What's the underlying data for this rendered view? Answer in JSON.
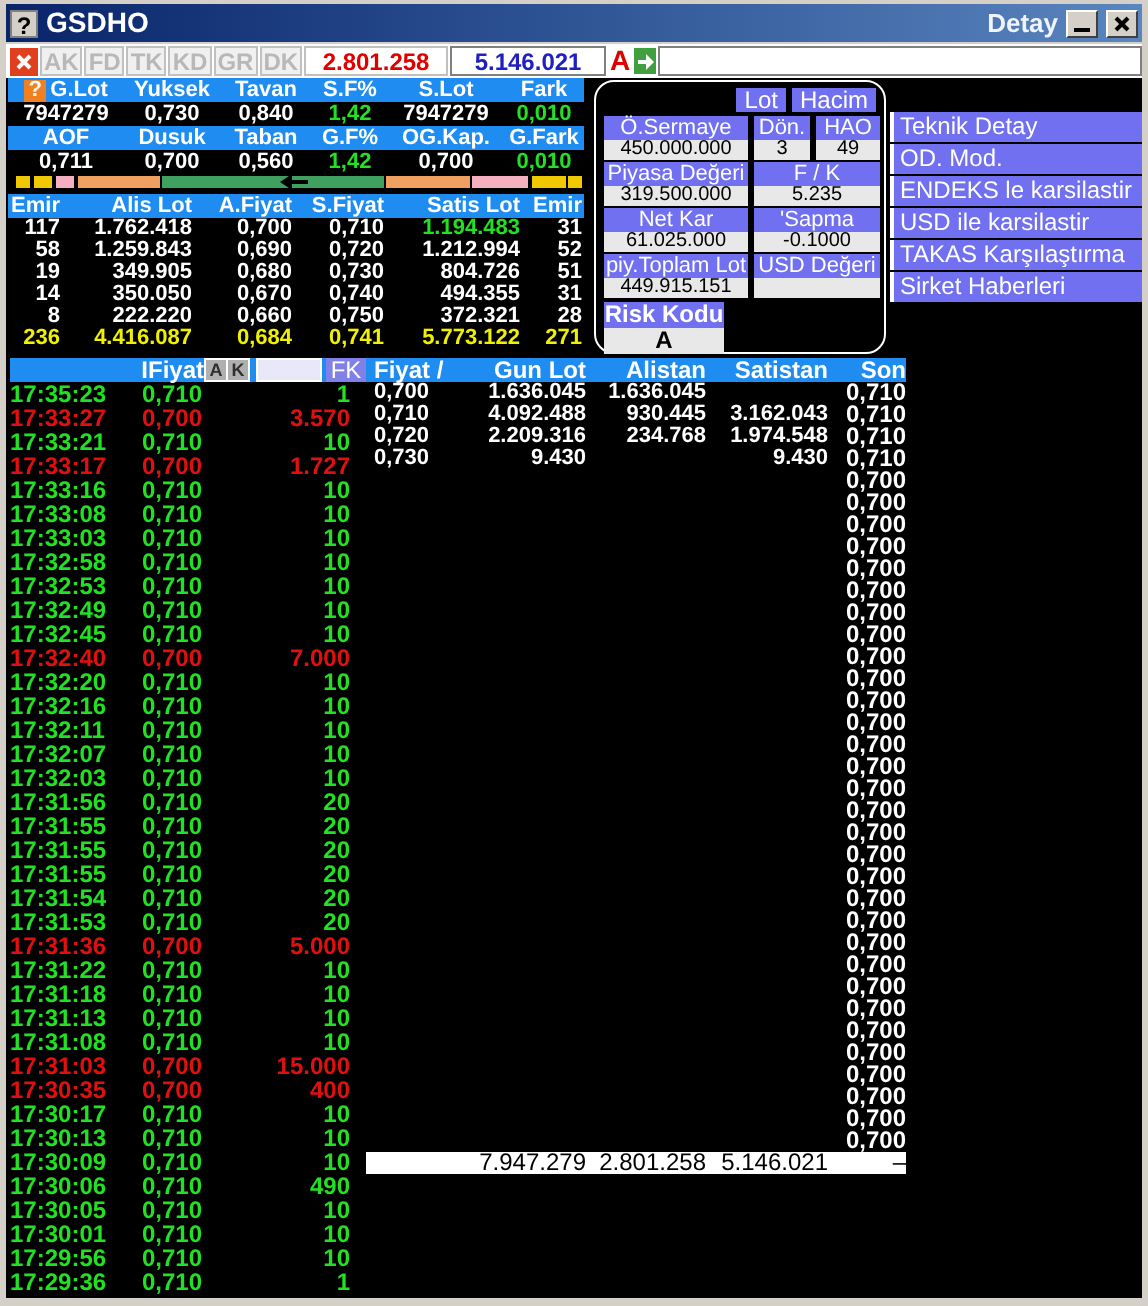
{
  "window": {
    "help": "?",
    "title": "GSDHO",
    "subtitle": "Detay"
  },
  "toolbar": {
    "tabs": [
      {
        "label": "AK",
        "disabled": true
      },
      {
        "label": "FD",
        "disabled": true
      },
      {
        "label": "TK",
        "disabled": true
      },
      {
        "label": "KD",
        "disabled": true
      },
      {
        "label": "GR",
        "disabled": true
      },
      {
        "label": "DK",
        "disabled": true
      }
    ],
    "buy_total": "2.801.258",
    "sell_total": "5.146.021",
    "flag": "A"
  },
  "summary": {
    "help": "?",
    "header_1": [
      "G.Lot",
      "Yuksek",
      "Tavan",
      "S.F%",
      "S.Lot",
      "Fark"
    ],
    "row_1": [
      "7947279",
      "0,730",
      "0,840",
      "1,42",
      "7947279",
      "0,010"
    ],
    "header_2": [
      "AOF",
      "Dusuk",
      "Taban",
      "G.F%",
      "OG.Kap.",
      "G.Fark"
    ],
    "row_2": [
      "0,711",
      "0,700",
      "0,560",
      "1,42",
      "0,700",
      "0,010"
    ]
  },
  "order_book": {
    "columns": [
      "Emir",
      "Alis Lot",
      "A.Fiyat",
      "S.Fiyat",
      "Satis Lot",
      "Emir"
    ],
    "rows": [
      {
        "cells": [
          "117",
          "1.762.418",
          "0,700",
          "0,710",
          "1.194.483",
          "31"
        ],
        "sell_changed": true
      },
      {
        "cells": [
          "58",
          "1.259.843",
          "0,690",
          "0,720",
          "1.212.994",
          "52"
        ],
        "sell_changed": false
      },
      {
        "cells": [
          "19",
          "349.905",
          "0,680",
          "0,730",
          "804.726",
          "51"
        ],
        "sell_changed": false
      },
      {
        "cells": [
          "14",
          "350.050",
          "0,670",
          "0,740",
          "494.355",
          "31"
        ],
        "sell_changed": false
      },
      {
        "cells": [
          "8",
          "222.220",
          "0,660",
          "0,750",
          "372.321",
          "28"
        ],
        "sell_changed": false
      }
    ],
    "totals": [
      "236",
      "4.416.087",
      "0,684",
      "0,741",
      "5.773.122",
      "271"
    ]
  },
  "info_panel": {
    "buttons": [
      "Lot",
      "Hacim"
    ],
    "fields": [
      {
        "label": "Ö.Sermaye",
        "value": "450.000.000"
      },
      {
        "label": "Dön.",
        "value": "3"
      },
      {
        "label": "HAO",
        "value": "49"
      },
      {
        "label": "Piyasa Değeri",
        "value": "319.500.000"
      },
      {
        "label": "F / K",
        "value": "5.235"
      },
      {
        "label": "Net Kar",
        "value": "61.025.000"
      },
      {
        "label": "'Sapma",
        "value": "-0.1000"
      },
      {
        "label": "piy.Toplam Lot",
        "value": "449.915.151"
      },
      {
        "label": "USD Değeri"
      }
    ],
    "risk": {
      "label": "Risk Kodu",
      "value": "A"
    }
  },
  "menu": [
    "Teknik Detay",
    "OD. Mod.",
    "ENDEKS le karsilastir",
    "USD ile karsilastir",
    "TAKAS Karşılaştırma",
    "Sirket Haberleri"
  ],
  "trades": {
    "header": "IFiyat",
    "buttons": [
      "A",
      "K"
    ],
    "filter_button": "FK",
    "rows": [
      {
        "time": "17:35:23",
        "price": "0,710",
        "lot": "1",
        "kind": "buy"
      },
      {
        "time": "17:33:27",
        "price": "0,700",
        "lot": "3.570",
        "kind": "sell"
      },
      {
        "time": "17:33:21",
        "price": "0,710",
        "lot": "10",
        "kind": "buy"
      },
      {
        "time": "17:33:17",
        "price": "0,700",
        "lot": "1.727",
        "kind": "sell"
      },
      {
        "time": "17:33:16",
        "price": "0,710",
        "lot": "10",
        "kind": "buy"
      },
      {
        "time": "17:33:08",
        "price": "0,710",
        "lot": "10",
        "kind": "buy"
      },
      {
        "time": "17:33:03",
        "price": "0,710",
        "lot": "10",
        "kind": "buy"
      },
      {
        "time": "17:32:58",
        "price": "0,710",
        "lot": "10",
        "kind": "buy"
      },
      {
        "time": "17:32:53",
        "price": "0,710",
        "lot": "10",
        "kind": "buy"
      },
      {
        "time": "17:32:49",
        "price": "0,710",
        "lot": "10",
        "kind": "buy"
      },
      {
        "time": "17:32:45",
        "price": "0,710",
        "lot": "10",
        "kind": "buy"
      },
      {
        "time": "17:32:40",
        "price": "0,700",
        "lot": "7.000",
        "kind": "sell"
      },
      {
        "time": "17:32:20",
        "price": "0,710",
        "lot": "10",
        "kind": "buy"
      },
      {
        "time": "17:32:16",
        "price": "0,710",
        "lot": "10",
        "kind": "buy"
      },
      {
        "time": "17:32:11",
        "price": "0,710",
        "lot": "10",
        "kind": "buy"
      },
      {
        "time": "17:32:07",
        "price": "0,710",
        "lot": "10",
        "kind": "buy"
      },
      {
        "time": "17:32:03",
        "price": "0,710",
        "lot": "10",
        "kind": "buy"
      },
      {
        "time": "17:31:56",
        "price": "0,710",
        "lot": "20",
        "kind": "buy"
      },
      {
        "time": "17:31:55",
        "price": "0,710",
        "lot": "20",
        "kind": "buy"
      },
      {
        "time": "17:31:55",
        "price": "0,710",
        "lot": "20",
        "kind": "buy"
      },
      {
        "time": "17:31:55",
        "price": "0,710",
        "lot": "20",
        "kind": "buy"
      },
      {
        "time": "17:31:54",
        "price": "0,710",
        "lot": "20",
        "kind": "buy"
      },
      {
        "time": "17:31:53",
        "price": "0,710",
        "lot": "20",
        "kind": "buy"
      },
      {
        "time": "17:31:36",
        "price": "0,700",
        "lot": "5.000",
        "kind": "sell"
      },
      {
        "time": "17:31:22",
        "price": "0,710",
        "lot": "10",
        "kind": "buy"
      },
      {
        "time": "17:31:18",
        "price": "0,710",
        "lot": "10",
        "kind": "buy"
      },
      {
        "time": "17:31:13",
        "price": "0,710",
        "lot": "10",
        "kind": "buy"
      },
      {
        "time": "17:31:08",
        "price": "0,710",
        "lot": "10",
        "kind": "buy"
      },
      {
        "time": "17:31:03",
        "price": "0,700",
        "lot": "15.000",
        "kind": "sell"
      },
      {
        "time": "17:30:35",
        "price": "0,700",
        "lot": "400",
        "kind": "sell"
      },
      {
        "time": "17:30:17",
        "price": "0,710",
        "lot": "10",
        "kind": "buy"
      },
      {
        "time": "17:30:13",
        "price": "0,710",
        "lot": "10",
        "kind": "buy"
      },
      {
        "time": "17:30:09",
        "price": "0,710",
        "lot": "10",
        "kind": "buy"
      },
      {
        "time": "17:30:06",
        "price": "0,710",
        "lot": "490",
        "kind": "buy"
      },
      {
        "time": "17:30:05",
        "price": "0,710",
        "lot": "10",
        "kind": "buy"
      },
      {
        "time": "17:30:01",
        "price": "0,710",
        "lot": "10",
        "kind": "buy"
      },
      {
        "time": "17:29:56",
        "price": "0,710",
        "lot": "10",
        "kind": "buy"
      },
      {
        "time": "17:29:36",
        "price": "0,710",
        "lot": "1",
        "kind": "buy"
      }
    ]
  },
  "depth": {
    "columns": [
      "Fiyat /",
      "Gun Lot",
      "Alistan",
      "Satistan",
      "Son"
    ],
    "rows": [
      [
        "0,700",
        "1.636.045",
        "1.636.045",
        ""
      ],
      [
        "0,710",
        "4.092.488",
        "930.445",
        "3.162.043"
      ],
      [
        "0,720",
        "2.209.316",
        "234.768",
        "1.974.548"
      ],
      [
        "0,730",
        "9.430",
        "",
        "9.430"
      ]
    ],
    "last_prices": [
      "0,710",
      "0,710",
      "0,710",
      "0,710",
      "0,700",
      "0,700",
      "0,700",
      "0,700",
      "0,700",
      "0,700",
      "0,700",
      "0,700",
      "0,700",
      "0,700",
      "0,700",
      "0,700",
      "0,700",
      "0,700",
      "0,700",
      "0,700",
      "0,700",
      "0,700",
      "0,700",
      "0,700",
      "0,700",
      "0,700",
      "0,700",
      "0,700",
      "0,700",
      "0,700",
      "0,700",
      "0,700",
      "0,700",
      "0,700",
      "0,700"
    ],
    "totals": [
      "7.947.279",
      "2.801.258",
      "5.146.021",
      "–"
    ]
  }
}
